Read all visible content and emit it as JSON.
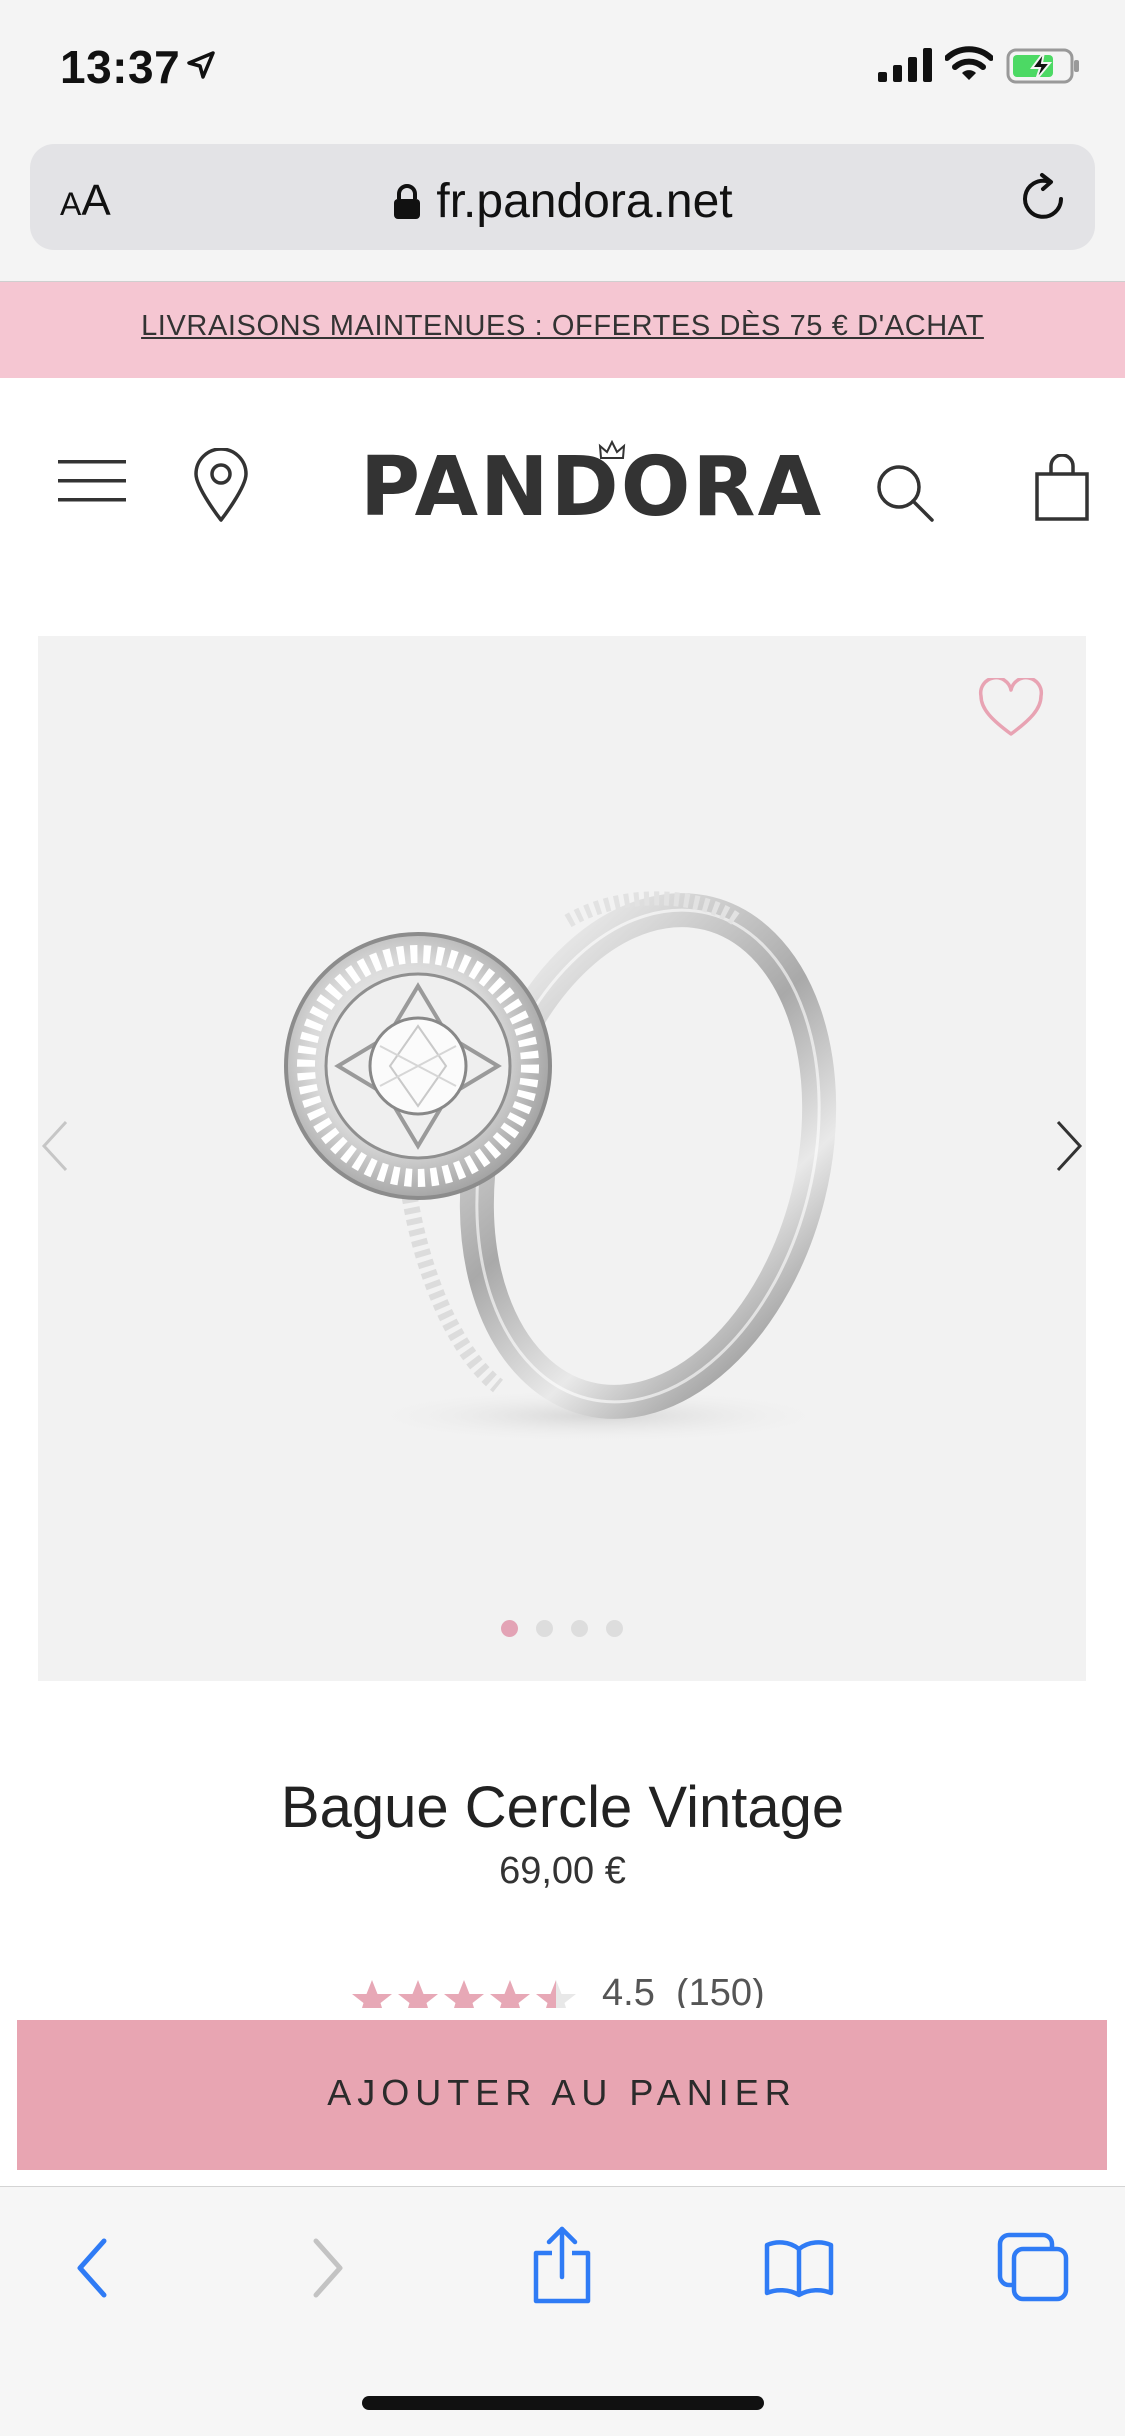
{
  "status_bar": {
    "time": "13:37",
    "icons": [
      "location-arrow-icon",
      "cellular-signal-icon",
      "wifi-icon",
      "battery-charging-icon"
    ]
  },
  "browser": {
    "text_size_label_small": "A",
    "text_size_label_large": "A",
    "url": "fr.pandora.net",
    "icons": [
      "lock-icon",
      "reload-icon"
    ]
  },
  "promo": {
    "text": "LIVRAISONS MAINTENUES : OFFERTES DÈS 75 € D'ACHAT"
  },
  "header": {
    "logo": "PANDORA",
    "icons": [
      "menu-icon",
      "store-locator-pin-icon",
      "search-icon",
      "shopping-bag-icon"
    ]
  },
  "gallery": {
    "icons": [
      "heart-icon",
      "chevron-left-icon",
      "chevron-right-icon"
    ],
    "image_count": 4,
    "active_index": 0,
    "colors": {
      "dot_active": "#e3a3b5",
      "dot_inactive": "#dddddd",
      "background": "#f2f2f2"
    }
  },
  "product": {
    "name": "Bague Cercle Vintage",
    "price": "69,00 €",
    "rating_value": "4.5",
    "review_count": "(150)",
    "rating_stars": 4.5
  },
  "cta": {
    "add_to_cart": "AJOUTER AU PANIER",
    "color": "#e8a5b2"
  },
  "toolbar": {
    "icons": [
      "back-icon",
      "forward-icon",
      "share-icon",
      "bookmarks-icon",
      "tabs-icon"
    ],
    "accent": "#2f7bf5"
  },
  "colors": {
    "promo_background": "#f5c6d2",
    "brand_text": "#333333"
  }
}
